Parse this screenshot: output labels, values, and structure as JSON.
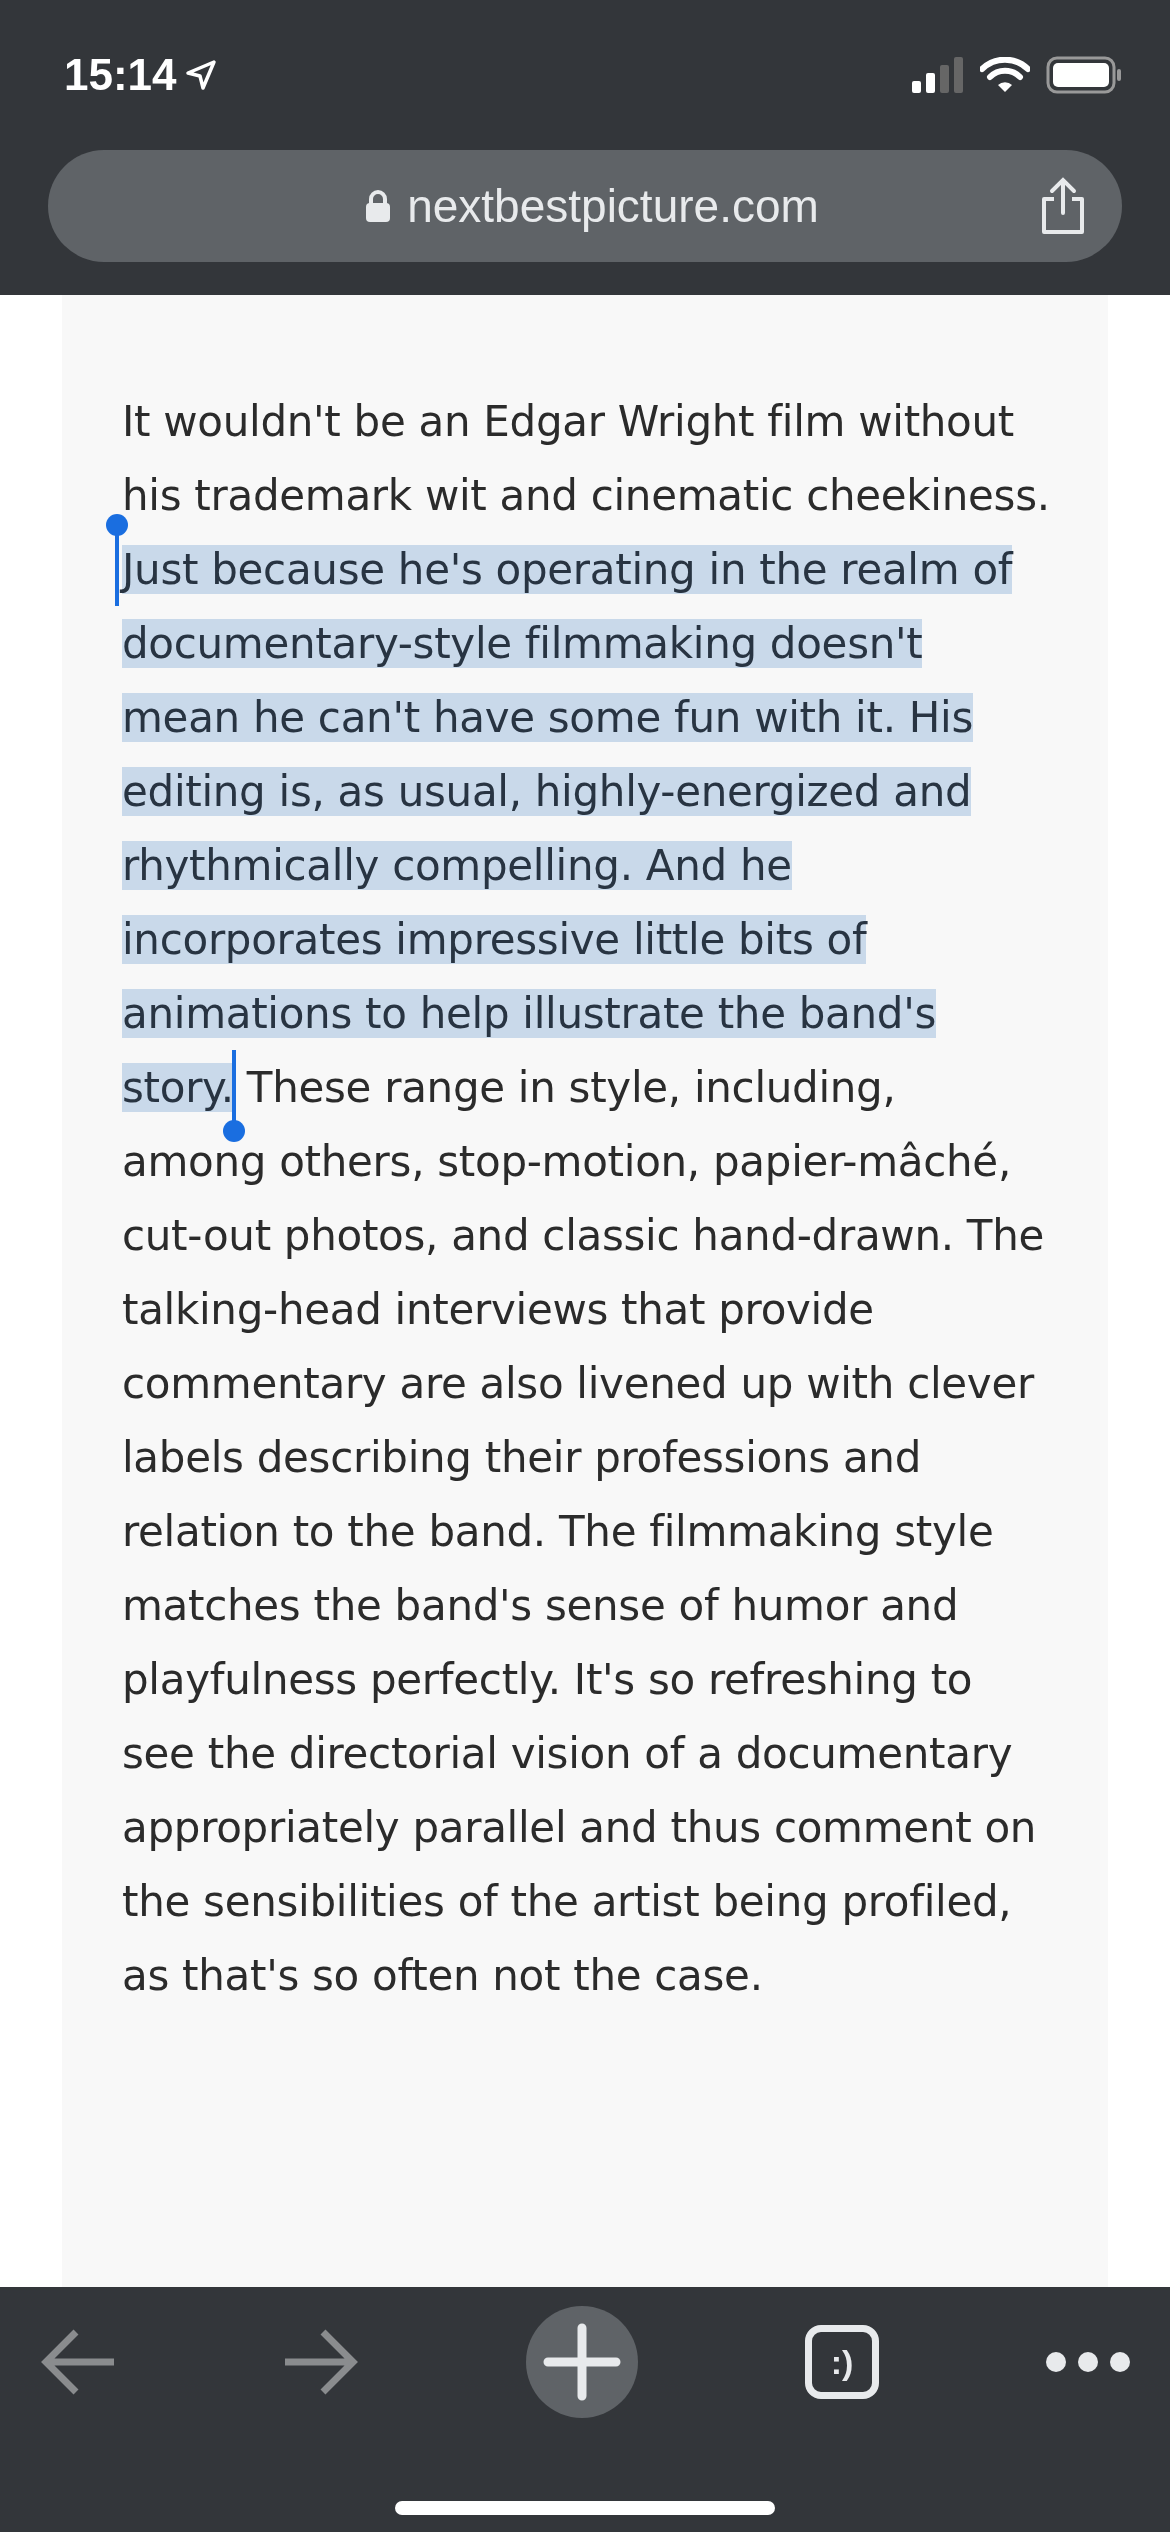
{
  "status_bar": {
    "time": "15:14"
  },
  "address_bar": {
    "url": "nextbestpicture.com"
  },
  "article": {
    "paragraph": [
      {
        "text": "It wouldn't be an Edgar Wright film without his trademark wit and cinematic cheekiness. ",
        "selected": false
      },
      {
        "text": "Just because he's operating in the realm of documentary-style filmmaking doesn't mean he can't have some fun with it. His editing is, as usual, highly-energized and rhythmically compelling. And he incorporates impressive little bits of animations to help illustrate the band's story.",
        "selected": true
      },
      {
        "text": " These range in style, including, among others, stop-motion, papier-mâché, cut-out photos, and classic hand-drawn. The talking-head interviews that provide commentary are also livened up with clever labels describing their professions and relation to the band. The filmmaking style matches the band's sense of humor and playfulness perfectly. It's so refreshing to see the directorial vision of a documentary appropriately parallel and thus comment on the sensibilities of the artist being profiled, as that's so often not the case.",
        "selected": false
      }
    ]
  },
  "toolbar": [
    {
      "kind": "back",
      "disabled": true
    },
    {
      "kind": "forward",
      "disabled": true
    },
    {
      "kind": "new-tab",
      "disabled": false
    },
    {
      "kind": "tabs",
      "label": ":)",
      "disabled": false
    },
    {
      "kind": "more",
      "disabled": false
    }
  ]
}
